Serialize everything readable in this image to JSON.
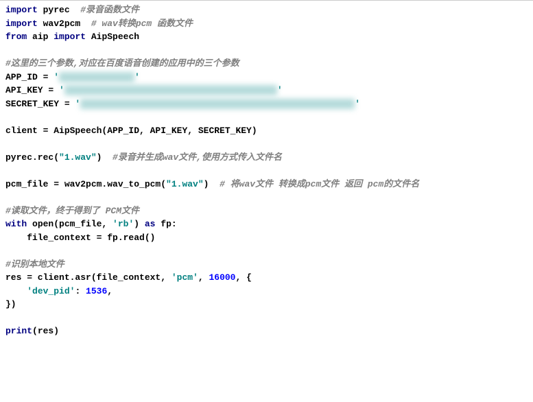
{
  "lines": {
    "l1_kw1": "import",
    "l1_name": " pyrec  ",
    "l1_comment": "#录音函数文件",
    "l2_kw1": "import",
    "l2_name": " wav2pcm  ",
    "l2_comment": "# wav转换pcm 函数文件",
    "l3_kw1": "from",
    "l3_name1": " aip ",
    "l3_kw2": "import",
    "l3_name2": " AipSpeech",
    "l4_comment": "#这里的三个参数,对应在百度语音创建的应用中的三个参数",
    "l5_text": "APP_ID = ",
    "l5_q1": "'",
    "l5_q2": "'",
    "l6_text": "API_KEY = ",
    "l6_q1": "'",
    "l6_q2": "'",
    "l7_text": "SECRET_KEY = ",
    "l7_q1": "'",
    "l7_q2": "'",
    "l8_text": "client = AipSpeech(APP_ID, API_KEY, SECRET_KEY)",
    "l9_text1": "pyrec.rec(",
    "l9_str": "\"1.wav\"",
    "l9_text2": ")  ",
    "l9_comment": "#录音并生成wav文件,使用方式传入文件名",
    "l10_text1": "pcm_file = wav2pcm.wav_to_pcm(",
    "l10_str": "\"1.wav\"",
    "l10_text2": ")  ",
    "l10_comment": "# 将wav文件 转换成pcm文件 返回 pcm的文件名",
    "l11_comment": "#读取文件，终于得到了 PCM文件",
    "l12_kw1": "with",
    "l12_text1": " open(pcm_file, ",
    "l12_str": "'rb'",
    "l12_text2": ") ",
    "l12_kw2": "as",
    "l12_text3": " fp:",
    "l13_text": "    file_context = fp.read()",
    "l14_comment": "#识别本地文件",
    "l15_text1": "res = client.asr(file_context, ",
    "l15_str": "'pcm'",
    "l15_text2": ", ",
    "l15_num": "16000",
    "l15_text3": ", {",
    "l16_text1": "    ",
    "l16_str": "'dev_pid'",
    "l16_text2": ": ",
    "l16_num": "1536",
    "l16_text3": ",",
    "l17_text": "})",
    "l18_kw": "print",
    "l18_text": "(res)"
  }
}
